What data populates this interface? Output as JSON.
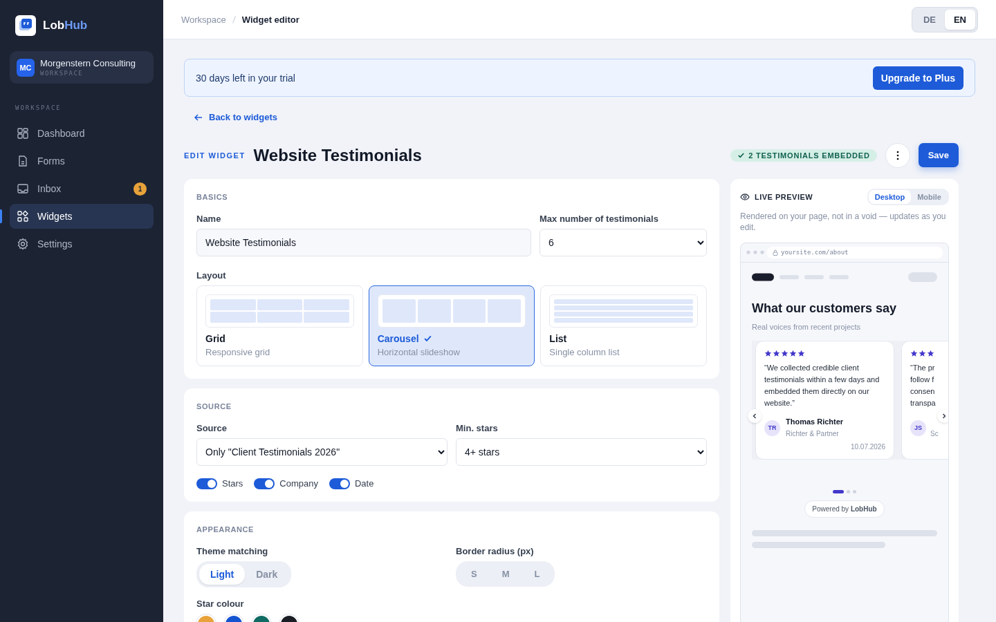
{
  "brand": {
    "name_parts": [
      "Lob",
      "Hub"
    ]
  },
  "workspace": {
    "initials": "MC",
    "name": "Morgenstern Consulting",
    "label": "WORKSPACE"
  },
  "nav": {
    "heading": "WORKSPACE",
    "items": [
      {
        "label": "Dashboard",
        "selected": false
      },
      {
        "label": "Forms",
        "selected": false
      },
      {
        "label": "Inbox",
        "selected": false,
        "badge": "1"
      },
      {
        "label": "Widgets",
        "selected": true
      },
      {
        "label": "Settings",
        "selected": false
      }
    ]
  },
  "topbar": {
    "breadcrumbs": [
      "Workspace",
      "Widget editor"
    ],
    "languages": [
      {
        "label": "DE",
        "selected": false
      },
      {
        "label": "EN",
        "selected": true
      }
    ]
  },
  "trial": {
    "text": "30 days left in your trial",
    "button": "Upgrade to Plus"
  },
  "back_link": "Back to widgets",
  "header": {
    "eyebrow": "EDIT WIDGET",
    "title": "Website Testimonials",
    "status": "2 TESTIMONIALS EMBEDDED",
    "save": "Save"
  },
  "basics": {
    "heading": "BASICS",
    "name_label": "Name",
    "name_value": "Website Testimonials",
    "max_label": "Max number of testimonials",
    "max_value": "6",
    "layout_label": "Layout",
    "layouts": [
      {
        "kind": "grid",
        "title": "Grid",
        "subtitle": "Responsive grid",
        "selected": false
      },
      {
        "kind": "carousel",
        "title": "Carousel",
        "subtitle": "Horizontal slideshow",
        "selected": true
      },
      {
        "kind": "list",
        "title": "List",
        "subtitle": "Single column list",
        "selected": false
      }
    ]
  },
  "source": {
    "heading": "SOURCE",
    "source_label": "Source",
    "source_value": "Only \"Client Testimonials 2026\"",
    "stars_label": "Min. stars",
    "stars_value": "4+ stars",
    "toggles": [
      {
        "label": "Stars",
        "on": true
      },
      {
        "label": "Company",
        "on": true
      },
      {
        "label": "Date",
        "on": true
      }
    ]
  },
  "appearance": {
    "heading": "APPEARANCE",
    "theme_label": "Theme matching",
    "themes": [
      {
        "label": "Light",
        "selected": true
      },
      {
        "label": "Dark",
        "selected": false
      }
    ],
    "radius_label": "Border radius (px)",
    "radii": [
      {
        "label": "S",
        "selected": false
      },
      {
        "label": "M",
        "selected": false
      },
      {
        "label": "L",
        "selected": false
      }
    ],
    "star_colour_label": "Star colour",
    "star_colours": [
      {
        "color": "#e8a23a"
      },
      {
        "color": "#1554d1"
      },
      {
        "color": "#0f6b63"
      },
      {
        "color": "#1a1d24"
      }
    ]
  },
  "preview": {
    "heading": "LIVE PREVIEW",
    "devices": [
      {
        "label": "Desktop",
        "selected": true
      },
      {
        "label": "Mobile",
        "selected": false
      }
    ],
    "description": "Rendered on your page, not in a void — updates as you edit.",
    "url": "yoursite.com/about",
    "title": "What our customers say",
    "subtitle": "Real voices from recent projects",
    "testimonials": [
      {
        "stars": 5,
        "quote": "“We collected credible client testimonials within a few days and embedded them directly on our website.”",
        "initials": "TR",
        "name": "Thomas Richter",
        "company": "Richter & Partner",
        "date": "10.07.2026"
      },
      {
        "stars": 3,
        "quote": "“The pr\nfollow f\nconsen\ntranspa",
        "initials": "JS",
        "company": "Sc"
      }
    ],
    "dots": [
      {
        "selected": true
      },
      {
        "selected": false
      },
      {
        "selected": false
      }
    ],
    "powered_by": "Powered by **LobHub**"
  }
}
